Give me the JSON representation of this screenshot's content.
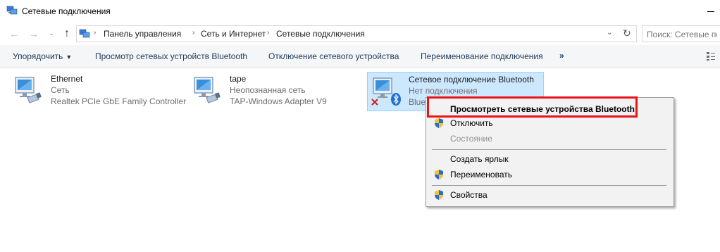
{
  "window": {
    "title": "Сетевые подключения"
  },
  "nav": {
    "back": "←",
    "forward": "→",
    "recent": "⌄",
    "up": "↑",
    "breadcrumb": [
      "Панель управления",
      "Сеть и Интернет",
      "Сетевые подключения"
    ],
    "separator": "›",
    "dropdown": "⌄",
    "refresh": "↻"
  },
  "search": {
    "placeholder": "Поиск: Сетевые подключения"
  },
  "commands": {
    "organize": "Упорядочить",
    "view_bt": "Просмотр сетевых устройств Bluetooth",
    "disable": "Отключение сетевого устройства",
    "rename": "Переименование подключения",
    "more": "»"
  },
  "connections": [
    {
      "name": "Ethernet",
      "status": "Сеть",
      "device": "Realtek PCIe GbE Family Controller"
    },
    {
      "name": "tape",
      "status": "Неопознанная сеть",
      "device": "TAP-Windows Adapter V9"
    },
    {
      "name": "Сетевое подключение Bluetooth",
      "status": "Нет подключения",
      "device": "Blue"
    }
  ],
  "context_menu": {
    "items": [
      {
        "label": "Просмотреть сетевые устройства Bluetooth",
        "bold": true,
        "shield": false,
        "disabled": false
      },
      {
        "label": "Отключить",
        "bold": false,
        "shield": true,
        "disabled": false
      },
      {
        "label": "Состояние",
        "bold": false,
        "shield": false,
        "disabled": true
      },
      {
        "label": "Создать ярлык",
        "bold": false,
        "shield": false,
        "disabled": false
      },
      {
        "label": "Переименовать",
        "bold": false,
        "shield": true,
        "disabled": false
      },
      {
        "label": "Свойства",
        "bold": false,
        "shield": true,
        "disabled": false
      }
    ]
  },
  "colors": {
    "accent": "#1e395b",
    "selection": "#cce8ff",
    "highlight": "#e8141a"
  }
}
